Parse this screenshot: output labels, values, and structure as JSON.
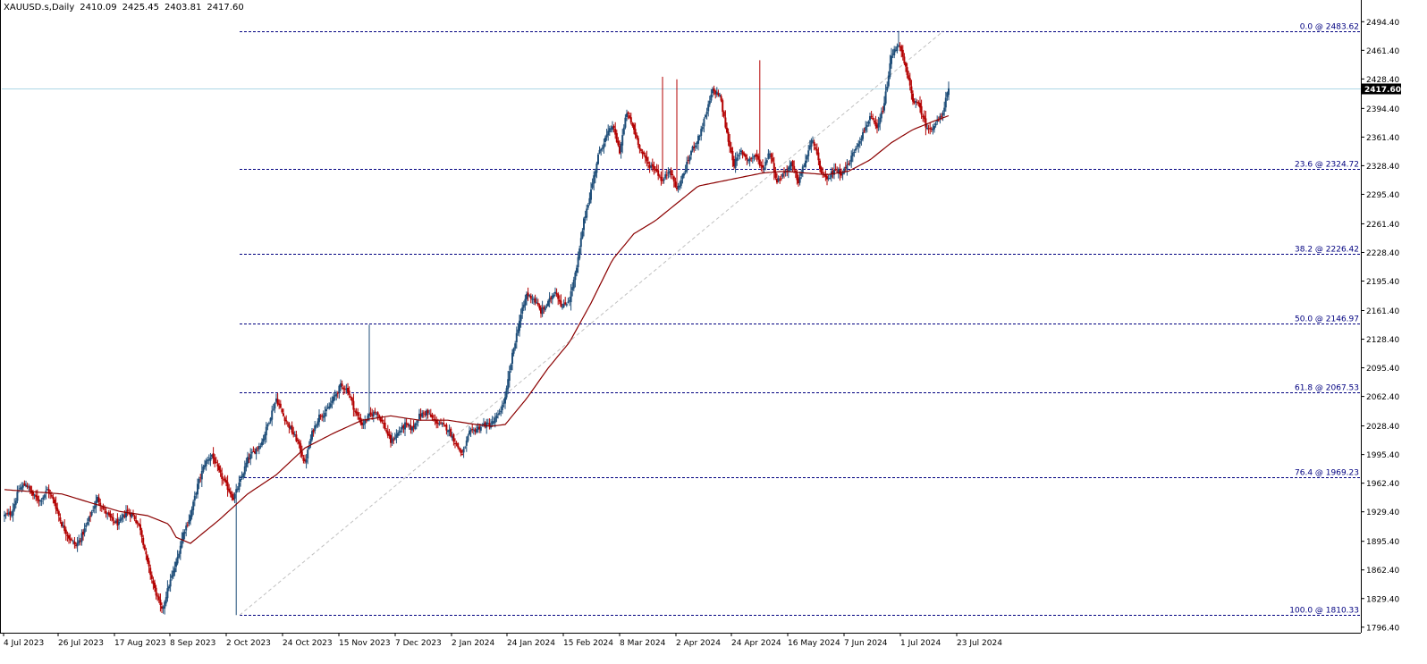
{
  "header": {
    "symbol": "XAUUSD.s,Daily",
    "open": "2410.09",
    "high": "2425.45",
    "low": "2403.81",
    "close": "2417.60"
  },
  "colors": {
    "background": "#ffffff",
    "bull_candle": "#1f4e79",
    "bear_candle": "#b30000",
    "moving_average": "#8b0000",
    "fib_line": "#000080",
    "current_price_line": "#add8e6",
    "current_price_label_bg": "#000000",
    "trend_line": "#c0c0c0",
    "axis": "#000000"
  },
  "chart_data": {
    "type": "candlestick",
    "symbol": "XAUUSD.s",
    "timeframe": "Daily",
    "ylim": [
      1790,
      2505
    ],
    "y_ticks": [
      "2494.40",
      "2461.40",
      "2428.40",
      "2394.40",
      "2361.40",
      "2328.40",
      "2295.40",
      "2261.40",
      "2228.40",
      "2195.40",
      "2161.40",
      "2128.40",
      "2095.40",
      "2062.40",
      "2028.40",
      "1995.40",
      "1962.40",
      "1929.40",
      "1895.40",
      "1862.40",
      "1829.40",
      "1796.40"
    ],
    "x_ticks": [
      "4 Jul 2023",
      "26 Jul 2023",
      "17 Aug 2023",
      "8 Sep 2023",
      "2 Oct 2023",
      "24 Oct 2023",
      "15 Nov 2023",
      "7 Dec 2023",
      "2 Jan 2024",
      "24 Jan 2024",
      "15 Feb 2024",
      "8 Mar 2024",
      "2 Apr 2024",
      "24 Apr 2024",
      "16 May 2024",
      "7 Jun 2024",
      "1 Jul 2024",
      "23 Jul 2024"
    ],
    "current_price": 2417.6,
    "current_price_label": "2417.60",
    "fibonacci_levels": [
      {
        "label": "0.0 @ 2483.62",
        "price": 2483.62
      },
      {
        "label": "23.6 @ 2324.72",
        "price": 2324.72
      },
      {
        "label": "38.2 @ 2226.42",
        "price": 2226.42
      },
      {
        "label": "50.0 @ 2146.97",
        "price": 2146.97
      },
      {
        "label": "61.8 @ 2067.53",
        "price": 2067.53
      },
      {
        "label": "76.4 @ 1969.23",
        "price": 1969.23
      },
      {
        "label": "100.0 @ 1810.33",
        "price": 1810.33
      }
    ],
    "trend_line": {
      "from_price": 1810.33,
      "to_price": 2483.62
    },
    "close_anchors": [
      [
        0,
        1925
      ],
      [
        5,
        1928
      ],
      [
        10,
        1955
      ],
      [
        15,
        1962
      ],
      [
        20,
        1948
      ],
      [
        25,
        1942
      ],
      [
        30,
        1955
      ],
      [
        35,
        1940
      ],
      [
        40,
        1915
      ],
      [
        45,
        1900
      ],
      [
        50,
        1890
      ],
      [
        55,
        1905
      ],
      [
        60,
        1925
      ],
      [
        65,
        1945
      ],
      [
        70,
        1930
      ],
      [
        75,
        1920
      ],
      [
        80,
        1915
      ],
      [
        85,
        1930
      ],
      [
        90,
        1925
      ],
      [
        95,
        1910
      ],
      [
        100,
        1870
      ],
      [
        105,
        1840
      ],
      [
        110,
        1815
      ],
      [
        115,
        1845
      ],
      [
        120,
        1870
      ],
      [
        125,
        1905
      ],
      [
        130,
        1925
      ],
      [
        135,
        1960
      ],
      [
        140,
        1985
      ],
      [
        145,
        1995
      ],
      [
        150,
        1975
      ],
      [
        155,
        1960
      ],
      [
        160,
        1945
      ],
      [
        165,
        1965
      ],
      [
        170,
        1990
      ],
      [
        175,
        2000
      ],
      [
        180,
        2010
      ],
      [
        185,
        2035
      ],
      [
        190,
        2060
      ],
      [
        195,
        2040
      ],
      [
        200,
        2025
      ],
      [
        205,
        2010
      ],
      [
        210,
        1985
      ],
      [
        215,
        2020
      ],
      [
        220,
        2040
      ],
      [
        225,
        2045
      ],
      [
        230,
        2060
      ],
      [
        235,
        2075
      ],
      [
        240,
        2070
      ],
      [
        245,
        2045
      ],
      [
        250,
        2030
      ],
      [
        255,
        2040
      ],
      [
        260,
        2045
      ],
      [
        265,
        2030
      ],
      [
        270,
        2010
      ],
      [
        275,
        2020
      ],
      [
        280,
        2030
      ],
      [
        285,
        2025
      ],
      [
        290,
        2040
      ],
      [
        295,
        2045
      ],
      [
        300,
        2035
      ],
      [
        305,
        2030
      ],
      [
        310,
        2025
      ],
      [
        315,
        2010
      ],
      [
        320,
        1995
      ],
      [
        325,
        2020
      ],
      [
        330,
        2025
      ],
      [
        335,
        2030
      ],
      [
        340,
        2030
      ],
      [
        345,
        2040
      ],
      [
        350,
        2060
      ],
      [
        355,
        2110
      ],
      [
        360,
        2150
      ],
      [
        365,
        2180
      ],
      [
        370,
        2175
      ],
      [
        375,
        2160
      ],
      [
        380,
        2170
      ],
      [
        385,
        2185
      ],
      [
        390,
        2165
      ],
      [
        395,
        2175
      ],
      [
        400,
        2210
      ],
      [
        405,
        2265
      ],
      [
        410,
        2300
      ],
      [
        415,
        2340
      ],
      [
        420,
        2360
      ],
      [
        425,
        2375
      ],
      [
        430,
        2345
      ],
      [
        435,
        2390
      ],
      [
        440,
        2370
      ],
      [
        445,
        2345
      ],
      [
        450,
        2330
      ],
      [
        455,
        2325
      ],
      [
        460,
        2310
      ],
      [
        465,
        2325
      ],
      [
        470,
        2300
      ],
      [
        475,
        2320
      ],
      [
        480,
        2345
      ],
      [
        485,
        2360
      ],
      [
        490,
        2385
      ],
      [
        495,
        2415
      ],
      [
        500,
        2410
      ],
      [
        505,
        2365
      ],
      [
        510,
        2330
      ],
      [
        515,
        2345
      ],
      [
        520,
        2335
      ],
      [
        525,
        2340
      ],
      [
        530,
        2325
      ],
      [
        535,
        2345
      ],
      [
        540,
        2310
      ],
      [
        545,
        2320
      ],
      [
        550,
        2330
      ],
      [
        555,
        2310
      ],
      [
        560,
        2335
      ],
      [
        565,
        2360
      ],
      [
        570,
        2325
      ],
      [
        575,
        2310
      ],
      [
        580,
        2325
      ],
      [
        585,
        2320
      ],
      [
        590,
        2330
      ],
      [
        595,
        2350
      ],
      [
        600,
        2365
      ],
      [
        605,
        2385
      ],
      [
        610,
        2370
      ],
      [
        615,
        2400
      ],
      [
        620,
        2455
      ],
      [
        625,
        2470
      ],
      [
        630,
        2440
      ],
      [
        635,
        2405
      ],
      [
        640,
        2395
      ],
      [
        645,
        2370
      ],
      [
        650,
        2375
      ],
      [
        655,
        2385
      ],
      [
        660,
        2417.6
      ]
    ],
    "ma_anchors": [
      [
        0,
        1955
      ],
      [
        40,
        1950
      ],
      [
        80,
        1930
      ],
      [
        100,
        1925
      ],
      [
        115,
        1915
      ],
      [
        120,
        1900
      ],
      [
        130,
        1893
      ],
      [
        150,
        1920
      ],
      [
        170,
        1950
      ],
      [
        190,
        1972
      ],
      [
        210,
        2003
      ],
      [
        230,
        2020
      ],
      [
        250,
        2035
      ],
      [
        270,
        2040
      ],
      [
        290,
        2035
      ],
      [
        310,
        2035
      ],
      [
        330,
        2030
      ],
      [
        340,
        2028
      ],
      [
        350,
        2030
      ],
      [
        365,
        2060
      ],
      [
        380,
        2095
      ],
      [
        395,
        2125
      ],
      [
        410,
        2170
      ],
      [
        425,
        2220
      ],
      [
        440,
        2250
      ],
      [
        455,
        2265
      ],
      [
        470,
        2285
      ],
      [
        485,
        2305
      ],
      [
        500,
        2310
      ],
      [
        515,
        2315
      ],
      [
        530,
        2320
      ],
      [
        545,
        2322
      ],
      [
        560,
        2320
      ],
      [
        575,
        2318
      ],
      [
        590,
        2322
      ],
      [
        605,
        2335
      ],
      [
        620,
        2355
      ],
      [
        635,
        2370
      ],
      [
        650,
        2380
      ],
      [
        660,
        2386
      ]
    ]
  }
}
